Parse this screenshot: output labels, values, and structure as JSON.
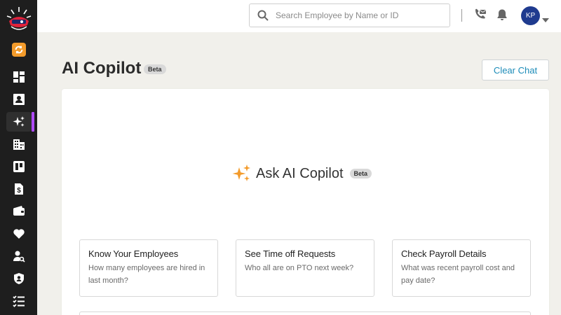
{
  "sidebar": {
    "items": [
      {
        "icon": "sync-icon"
      },
      {
        "icon": "dashboard-icon"
      },
      {
        "icon": "employee-card-icon"
      },
      {
        "icon": "ai-sparkle-icon",
        "active": true
      },
      {
        "icon": "building-icon"
      },
      {
        "icon": "board-icon"
      },
      {
        "icon": "payroll-document-icon"
      },
      {
        "icon": "wallet-icon"
      },
      {
        "icon": "heart-icon"
      },
      {
        "icon": "user-search-icon"
      },
      {
        "icon": "shield-user-icon"
      },
      {
        "icon": "checklist-icon"
      }
    ],
    "active_color": "#b04bff"
  },
  "header": {
    "search_placeholder": "Search Employee by Name or ID",
    "avatar_initials": "KP",
    "avatar_color": "#1f3b8f"
  },
  "page": {
    "title": "AI Copilot",
    "badge": "Beta",
    "clear_button": "Clear Chat"
  },
  "main": {
    "heading": "Ask AI Copilot",
    "badge": "Beta",
    "accent_color": "#f39b2b",
    "suggestions": [
      {
        "title": "Know Your Employees",
        "subtitle": "How many employees are hired in last month?"
      },
      {
        "title": "See Time off Requests",
        "subtitle": "Who all are on PTO next week?"
      },
      {
        "title": "Check Payroll Details",
        "subtitle": "What was recent payroll cost and pay date?"
      }
    ]
  }
}
